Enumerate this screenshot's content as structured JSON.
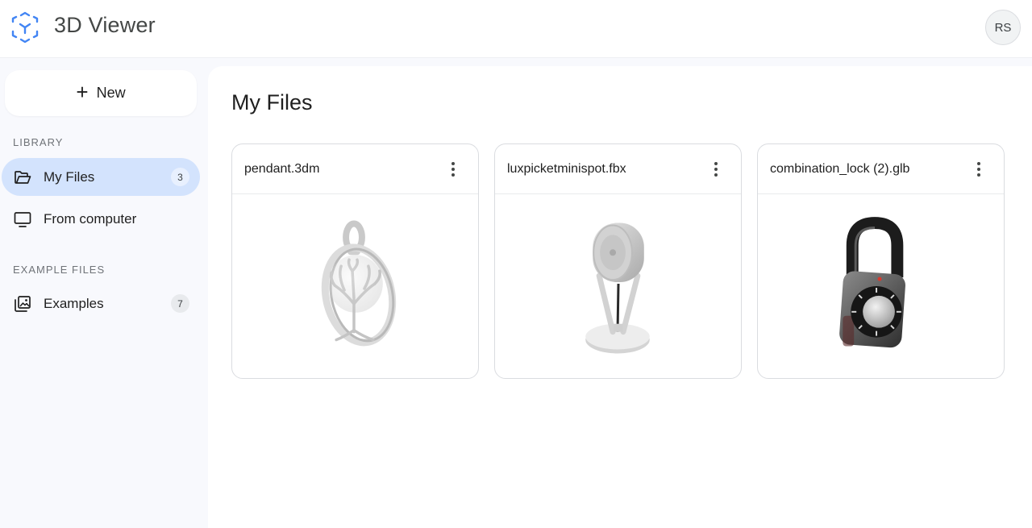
{
  "header": {
    "app_title": "3D Viewer",
    "avatar_initials": "RS"
  },
  "sidebar": {
    "new_button_label": "New",
    "new_button_icon": "plus-icon",
    "library_heading": "LIBRARY",
    "library_items": [
      {
        "label": "My Files",
        "icon": "folder-open-icon",
        "count": "3",
        "active": true
      },
      {
        "label": "From computer",
        "icon": "monitor-icon",
        "active": false
      }
    ],
    "examples_heading": "EXAMPLE FILES",
    "example_items": [
      {
        "label": "Examples",
        "icon": "image-gallery-icon",
        "count": "7",
        "active": false
      }
    ]
  },
  "main": {
    "title": "My Files",
    "files": [
      {
        "name": "pendant.3dm",
        "thumbnail": "tree-of-life-pendant"
      },
      {
        "name": "luxpicketminispot.fbx",
        "thumbnail": "mini-spotlight"
      },
      {
        "name": "combination_lock (2).glb",
        "thumbnail": "combination-lock"
      }
    ]
  },
  "colors": {
    "accent_active_bg": "#d3e3fd",
    "logo_blue": "#4285f4",
    "page_bg": "#f8f9fd"
  }
}
